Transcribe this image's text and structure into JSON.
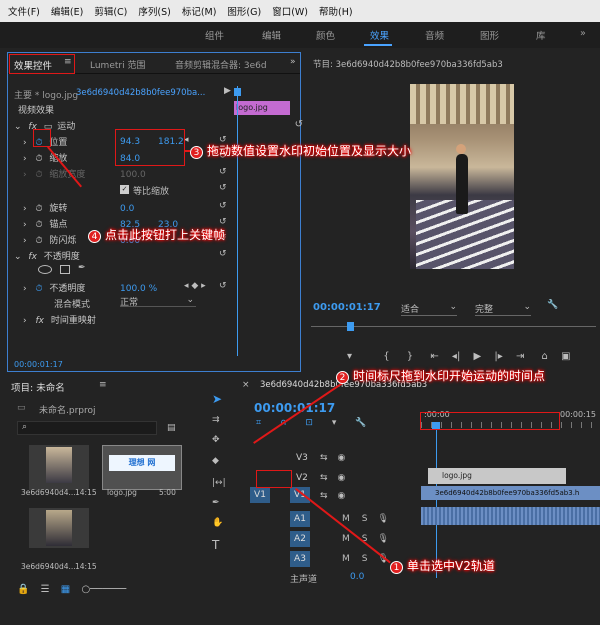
{
  "menu": [
    "文件(F)",
    "编辑(E)",
    "剪辑(C)",
    "序列(S)",
    "标记(M)",
    "图形(G)",
    "窗口(W)",
    "帮助(H)"
  ],
  "workspaces": [
    "组件",
    "编辑",
    "颜色",
    "效果",
    "音频",
    "图形",
    "库"
  ],
  "active_workspace": "效果",
  "effect_controls": {
    "tabs": [
      "效果控件",
      "Lumetri 范围",
      "音频剪辑混合器: 3e6d"
    ],
    "master_label": "主要 * logo.jpg",
    "sequence_label": "3e6d6940d42b8b0fee970ba...",
    "clip_name": "logo.jpg",
    "video_effects": "视频效果",
    "motion": "运动",
    "position": "位置",
    "position_x": "94.3",
    "position_y": "181.2",
    "scale": "缩放",
    "scale_value": "84.0",
    "scale_width": "缩放宽度",
    "scale_width_value": "100.0",
    "uniform_scale": "等比缩放",
    "rotation": "旋转",
    "rotation_value": "0.0",
    "anchor": "锚点",
    "anchor_x": "82.5",
    "anchor_y": "23.0",
    "anti_flicker": "防闪烁",
    "anti_flicker_value": "0.00",
    "opacity_group": "不透明度",
    "opacity": "不透明度",
    "opacity_value": "100.0 %",
    "blend_mode": "混合模式",
    "blend_value": "正常",
    "time_remap": "时间重映射",
    "timecode": "00:00:01:17"
  },
  "program": {
    "title": "节目: 3e6d6940d42b8b0fee970ba336fd5ab3",
    "timecode": "00:00:01:17",
    "fit": "适合",
    "quality": "完整"
  },
  "project": {
    "title": "项目: 未命名",
    "file": "未命名.prproj",
    "items": [
      {
        "name": "3e6d6940d4...",
        "duration": "14:15"
      },
      {
        "name": "logo.jpg",
        "duration": "5:00"
      },
      {
        "name": "3e6d6940d4...",
        "duration": "14:15"
      }
    ]
  },
  "timeline": {
    "title": "3e6d6940d42b8b0fee970ba336fd5ab3",
    "timecode": "00:00:01:17",
    "ruler": [
      ":00:00",
      "00:00:15"
    ],
    "tracks": [
      "V3",
      "V2",
      "V1",
      "A1",
      "A2",
      "A3"
    ],
    "source_v": "V1",
    "source_a": "A1",
    "logo_clip": "logo.jpg",
    "video_clip": "3e6d6940d42b8b0fee970ba336fd5ab3.h",
    "master": "主声道",
    "master_value": "0.0",
    "m": "M",
    "s": "S"
  },
  "callouts": {
    "c1": {
      "num": "1",
      "text": "单击选中V2轨道"
    },
    "c2": {
      "num": "2",
      "text": "时间标尺拖到水印开始运动的时间点"
    },
    "c3": {
      "num": "3",
      "text": "拖动数值设置水印初始位置及显示大小"
    },
    "c4": {
      "num": "4",
      "text": "点击此按钮打上关键帧"
    }
  },
  "colors": {
    "accent": "#3d9bf0",
    "annotation": "#e01818",
    "video_clip": "#6c8fc4",
    "logo_clip": "#c8c8c8"
  }
}
